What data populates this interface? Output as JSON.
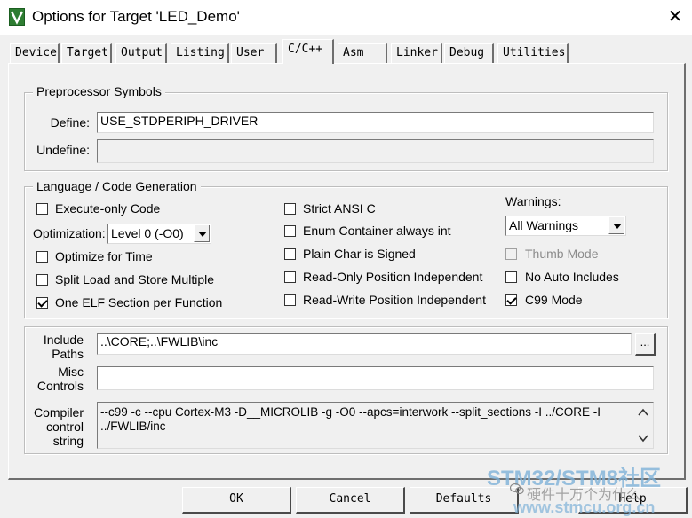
{
  "window": {
    "title": "Options for Target 'LED_Demo'",
    "close_glyph": "✕",
    "icon": "keil-app-icon"
  },
  "tabs": [
    {
      "label": "Device"
    },
    {
      "label": "Target"
    },
    {
      "label": "Output"
    },
    {
      "label": "Listing"
    },
    {
      "label": "User"
    },
    {
      "label": "C/C++",
      "active": true
    },
    {
      "label": "Asm"
    },
    {
      "label": "Linker"
    },
    {
      "label": "Debug"
    },
    {
      "label": "Utilities"
    }
  ],
  "preprocessor": {
    "title": "Preprocessor Symbols",
    "define_label": "Define:",
    "define_value": "USE_STDPERIPH_DRIVER",
    "undefine_label": "Undefine:",
    "undefine_value": ""
  },
  "language": {
    "title": "Language / Code Generation",
    "execute_only": {
      "label": "Execute-only Code",
      "checked": false
    },
    "optimization_label": "Optimization:",
    "optimization_value": "Level 0 (-O0)",
    "optimize_time": {
      "label": "Optimize for Time",
      "checked": false
    },
    "split_load": {
      "label": "Split Load and Store Multiple",
      "checked": false
    },
    "one_elf": {
      "label": "One ELF Section per Function",
      "checked": true
    },
    "strict_ansi": {
      "label": "Strict ANSI C",
      "checked": false
    },
    "enum_container": {
      "label": "Enum Container always int",
      "checked": false
    },
    "plain_char": {
      "label": "Plain Char is Signed",
      "checked": false
    },
    "ro_pi": {
      "label": "Read-Only Position Independent",
      "checked": false
    },
    "rw_pi": {
      "label": "Read-Write Position Independent",
      "checked": false
    },
    "warnings_label": "Warnings:",
    "warnings_value": "All Warnings",
    "thumb_mode": {
      "label": "Thumb Mode",
      "checked": false,
      "disabled": true
    },
    "no_auto_includes": {
      "label": "No Auto Includes",
      "checked": false
    },
    "c99_mode": {
      "label": "C99 Mode",
      "checked": true
    }
  },
  "include_paths": {
    "label_line1": "Include",
    "label_line2": "Paths",
    "value": "..\\CORE;..\\FWLIB\\inc",
    "browse_label": "..."
  },
  "misc_controls": {
    "label_line1": "Misc",
    "label_line2": "Controls",
    "value": ""
  },
  "compiler_control": {
    "label_line1": "Compiler",
    "label_line2": "control",
    "label_line3": "string",
    "line1": "--c99 -c --cpu Cortex-M3 -D__MICROLIB -g -O0 --apcs=interwork --split_sections -I ../CORE -I",
    "line2": "../FWLIB/inc"
  },
  "buttons": {
    "ok": "OK",
    "cancel": "Cancel",
    "defaults": "Defaults",
    "help": "Help"
  },
  "watermark": {
    "site": "STM32/STM8社区",
    "author": "硬件十万个为什么",
    "url": "www.stmcu.org.cn"
  },
  "colors": {
    "dialog_bg": "#f0f0f0",
    "border_dark": "#6e6e6e",
    "watermark_blue": "#7fb2d9"
  }
}
